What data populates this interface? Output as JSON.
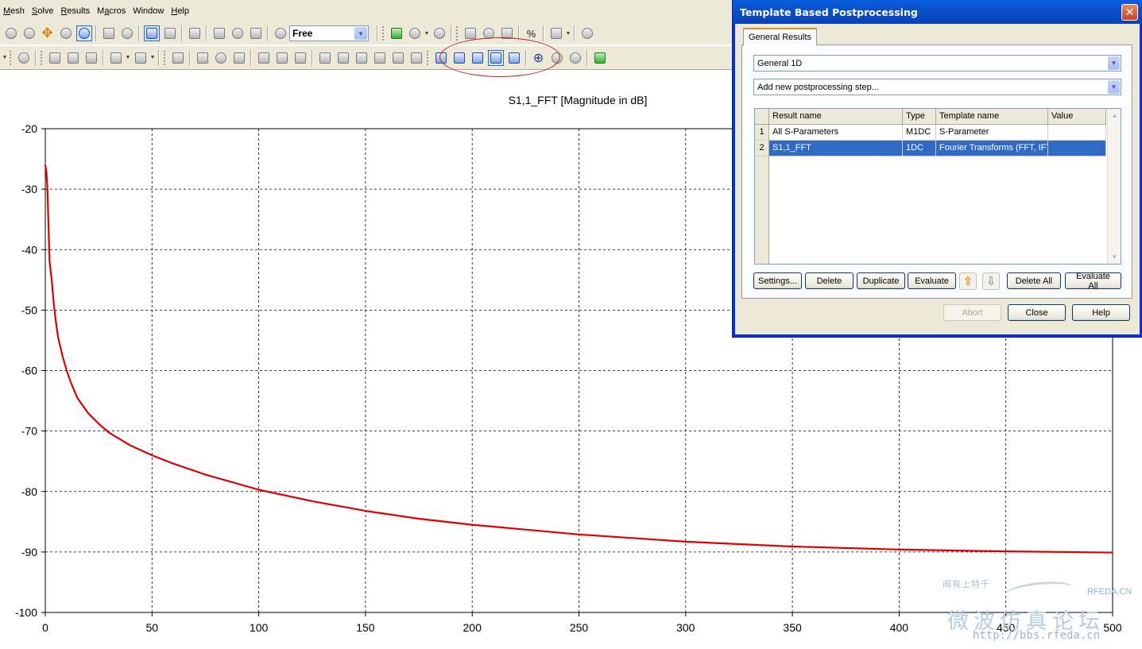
{
  "menubar": {
    "items": [
      {
        "label": "Mesh",
        "accel": "M"
      },
      {
        "label": "Solve",
        "accel": "S"
      },
      {
        "label": "Results",
        "accel": "R"
      },
      {
        "label": "Macros",
        "accel": "a"
      },
      {
        "label": "Window",
        "accel": ""
      },
      {
        "label": "Help",
        "accel": "H"
      }
    ]
  },
  "toolbar": {
    "mode_select_value": "Free"
  },
  "chart_data": {
    "type": "line",
    "title": "S1,1_FFT [Magnitude in dB]",
    "xlabel": "",
    "ylabel": "",
    "xlim": [
      0,
      500
    ],
    "ylim": [
      -100,
      -20
    ],
    "xticks": [
      0,
      50,
      100,
      150,
      200,
      250,
      300,
      350,
      400,
      450,
      500
    ],
    "yticks": [
      -20,
      -30,
      -40,
      -50,
      -60,
      -70,
      -80,
      -90,
      -100
    ],
    "grid": true,
    "grid_style": "dashed",
    "line_color": "#dd0000",
    "series": [
      {
        "x": [
          0,
          0.5,
          1,
          1.5,
          2,
          3,
          4,
          5,
          6,
          8,
          10,
          12,
          15,
          20,
          25,
          30,
          40,
          50,
          60,
          75,
          100,
          125,
          150,
          175,
          200,
          250,
          300,
          350,
          400,
          450,
          500
        ],
        "y": [
          -26,
          -27,
          -30,
          -36,
          -42,
          -45,
          -49,
          -52,
          -54.5,
          -57.5,
          -60,
          -62,
          -64.5,
          -67,
          -68.8,
          -70.3,
          -72.4,
          -74,
          -75.4,
          -77.2,
          -79.7,
          -81.6,
          -83.2,
          -84.5,
          -85.5,
          -87.1,
          -88.3,
          -89.1,
          -89.6,
          -89.9,
          -90.1
        ]
      }
    ]
  },
  "dialog": {
    "title": "Template Based Postprocessing",
    "tab_label": "General Results",
    "category_select": "General 1D",
    "add_step_select": "Add new postprocessing step...",
    "table": {
      "columns": [
        "Result name",
        "Type",
        "Template name",
        "Value"
      ],
      "rows": [
        {
          "num": "1",
          "result_name": "All S-Parameters",
          "type": "M1DC",
          "template": "S-Parameter",
          "value": ""
        },
        {
          "num": "2",
          "result_name": "S1,1_FFT",
          "type": "1DC",
          "template": "Fourier Transforms (FFT, IFT,",
          "value": ""
        }
      ]
    },
    "buttons": {
      "settings": "Settings...",
      "delete": "Delete",
      "duplicate": "Duplicate",
      "evaluate": "Evaluate",
      "delete_all": "Delete All",
      "evaluate_all": "Evaluate All",
      "abort": "Abort",
      "close": "Close",
      "help": "Help"
    }
  },
  "watermark": {
    "line1": "闻有上特千 ",
    "rfeda": "RFEDA.CN",
    "cn_title": "微波仿真论坛",
    "url": "http://bbs.rfeda.cn"
  }
}
